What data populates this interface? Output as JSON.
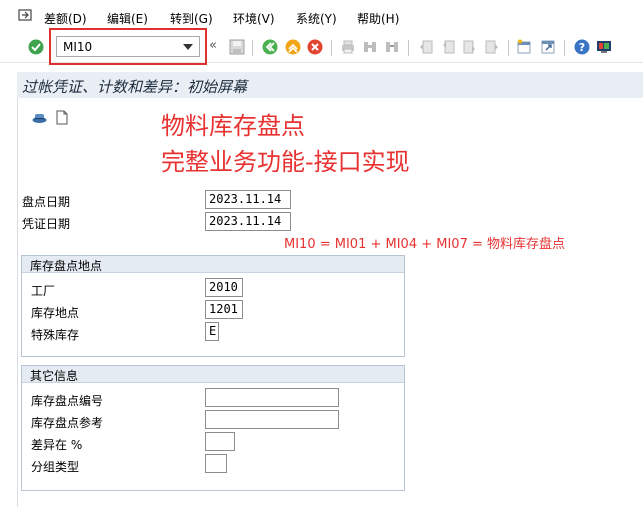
{
  "menu": {
    "items": [
      {
        "label": "差额(D)"
      },
      {
        "label": "编辑(E)"
      },
      {
        "label": "转到(G)"
      },
      {
        "label": "环境(V)"
      },
      {
        "label": "系统(Y)"
      },
      {
        "label": "帮助(H)"
      }
    ]
  },
  "toolbar": {
    "command_value": "MI10"
  },
  "screen": {
    "title": "过帐凭证、计数和差异：初始屏幕"
  },
  "annotations": {
    "line1": "物料库存盘点",
    "line2": "完整业务功能-接口实现",
    "formula": "MI10 = MI01 + MI04 + MI07 = 物料库存盘点"
  },
  "header_fields": {
    "count_date_label": "盘点日期",
    "count_date_value": "2023.11.14",
    "doc_date_label": "凭证日期",
    "doc_date_value": "2023.11.14"
  },
  "location_group": {
    "title": "库存盘点地点",
    "plant_label": "工厂",
    "plant_value": "2010",
    "sloc_label": "库存地点",
    "sloc_value": "1201",
    "special_label": "特殊库存",
    "special_value": "E"
  },
  "other_group": {
    "title": "其它信息",
    "doc_no_label": "库存盘点编号",
    "doc_no_value": "",
    "ref_label": "库存盘点参考",
    "ref_value": "",
    "diff_label": "差异在 %",
    "diff_value": "",
    "group_type_label": "分组类型",
    "group_type_value": ""
  },
  "colors": {
    "annotation_red": "#e83232",
    "title_bar": "#e9eef4"
  }
}
